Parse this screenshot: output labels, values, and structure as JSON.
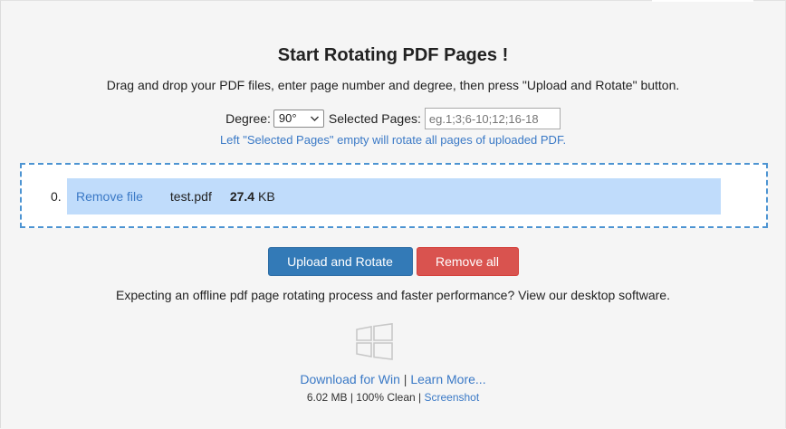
{
  "title": "Start Rotating PDF Pages !",
  "instructions": "Drag and drop your PDF files, enter page number and degree, then press \"Upload and Rotate\" button.",
  "controls": {
    "degree_label": "Degree:",
    "degree_value": "90°",
    "pages_label": "Selected Pages:",
    "pages_value": "",
    "pages_placeholder": "eg.1;3;6-10;12;16-18"
  },
  "note": "Left \"Selected Pages\" empty will rotate all pages of uploaded PDF.",
  "files": [
    {
      "index": "0.",
      "remove_label": "Remove file",
      "name": "test.pdf",
      "size_value": "27.4",
      "size_unit": "KB"
    }
  ],
  "buttons": {
    "upload": "Upload and Rotate",
    "remove_all": "Remove all"
  },
  "offline_text": "Expecting an offline pdf page rotating process and faster performance? View our desktop software.",
  "download": {
    "win_label": "Download for Win",
    "separator": " | ",
    "learn_label": "Learn More...",
    "meta_text": "6.02 MB | 100% Clean | ",
    "screenshot_label": "Screenshot"
  },
  "colors": {
    "primary": "#337ab7",
    "danger": "#d9534f",
    "link": "#3a79c6",
    "dropzone_border": "#4d94d2",
    "file_row_bg": "#c0dcfb"
  },
  "icons": {
    "os": "windows-icon",
    "select_arrow": "chevron-down-icon"
  }
}
